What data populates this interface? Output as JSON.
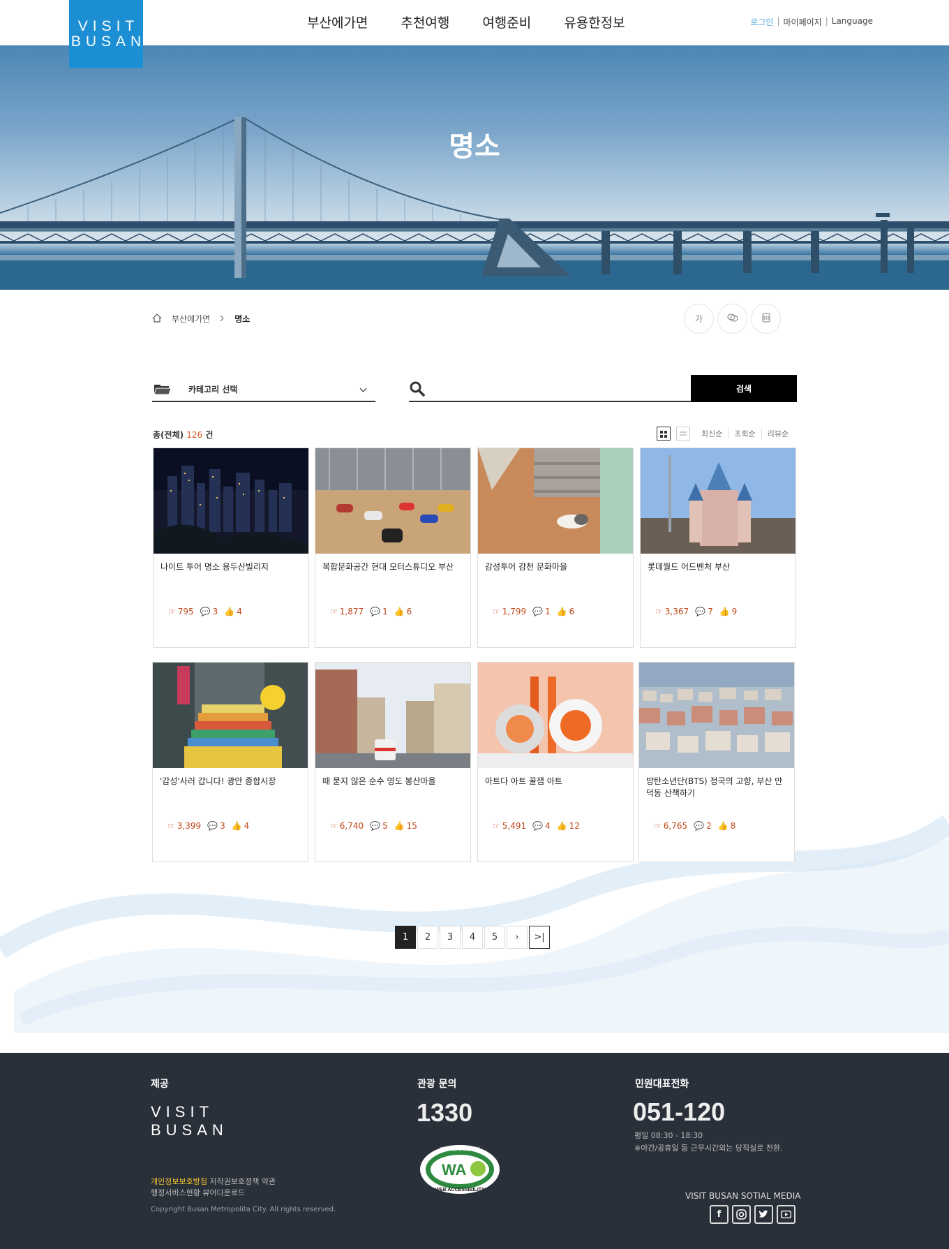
{
  "header": {
    "logo_line1": "VISIT",
    "logo_line2": "BUSAN",
    "nav": [
      "부산에가면",
      "추천여행",
      "여행준비",
      "유용한정보"
    ],
    "util": {
      "login": "로그인",
      "mypage": "마이페이지",
      "language": "Language",
      "sep": "|"
    }
  },
  "hero": {
    "title": "명소"
  },
  "breadcrumb": {
    "level1": "부산에가면",
    "current": "명소"
  },
  "tools": {
    "font_label": "가"
  },
  "search": {
    "category_label": "카테고리 선택",
    "query": "",
    "button": "검색"
  },
  "listing": {
    "total_prefix": "총(전체)",
    "total_count": "126",
    "total_suffix": "건",
    "sorts": [
      "최신순",
      "조회순",
      "리뷰순"
    ]
  },
  "cards": [
    {
      "title": "나이트 투어 명소 용두산빌리지",
      "views": "795",
      "comments": "3",
      "likes": "4"
    },
    {
      "title": "복합문화공간 현대 모터스튜디오 부산",
      "views": "1,877",
      "comments": "1",
      "likes": "6"
    },
    {
      "title": "감성투어 감천 문화마을",
      "views": "1,799",
      "comments": "1",
      "likes": "6"
    },
    {
      "title": "롯데월드 어드벤처 부산",
      "views": "3,367",
      "comments": "7",
      "likes": "9"
    },
    {
      "title": "'감성'사러 갑니다! 광안 종합시장",
      "views": "3,399",
      "comments": "3",
      "likes": "4"
    },
    {
      "title": "때 묻지 않은 순수 영도 봉산마을",
      "views": "6,740",
      "comments": "5",
      "likes": "15"
    },
    {
      "title": "아트다 아트 꿀잼 아트",
      "views": "5,491",
      "comments": "4",
      "likes": "12"
    },
    {
      "title": "방탄소년단(BTS) 정국의 고향, 부산 만덕동 산책하기",
      "views": "6,765",
      "comments": "2",
      "likes": "8"
    }
  ],
  "pagination": {
    "pages": [
      "1",
      "2",
      "3",
      "4",
      "5"
    ],
    "next": "›",
    "last": ">|",
    "current": "1"
  },
  "footer": {
    "provider_title": "제공",
    "logo_line1": "VISIT",
    "logo_line2": "BUSAN",
    "tour_title": "관광 문의",
    "tour_number": "1330",
    "civil_title": "민원대표전화",
    "civil_number": "051-120",
    "hours": "평일 08:30 - 18:30",
    "night_note": "※야간/공휴일 등 근무시간외는 당직실로 전환.",
    "privacy": "개인정보보호방침",
    "copyright_policy": "저작권보호정책",
    "terms": "약관",
    "admin_status": "행정서비스현황",
    "viewer": "뷰어다운로드",
    "copyright": "Copyright Busan Metropolita City. All rights reserved.",
    "social_title": "VISIT BUSAN SOTIAL MEDIA",
    "wa_badge": "WA",
    "wa_ring_text": "WEB ACCESSIBILITY",
    "wa_top_text": "과학기술정보통신부"
  },
  "colors": {
    "brand_blue": "#1b8ed4",
    "accent_orange": "#e05a2b",
    "footer_bg": "#2a3039"
  }
}
